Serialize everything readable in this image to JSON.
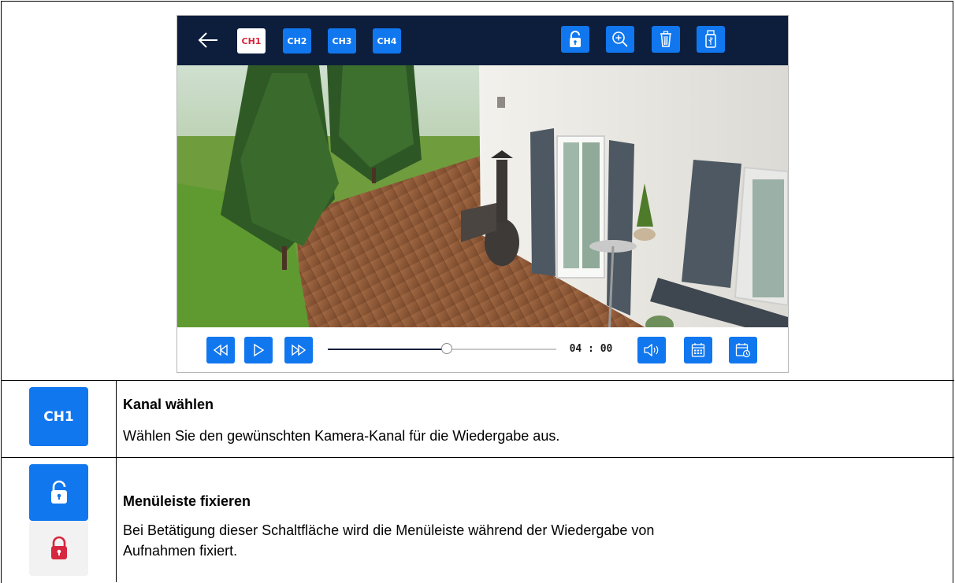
{
  "device": {
    "channels": [
      {
        "label": "CH1",
        "active": true
      },
      {
        "label": "CH2",
        "active": false
      },
      {
        "label": "CH3",
        "active": false
      },
      {
        "label": "CH4",
        "active": false
      }
    ],
    "toolbar_icons": [
      "lock-open-icon",
      "zoom-in-icon",
      "trash-icon",
      "usb-icon"
    ],
    "playback_icons": [
      "rewind-icon",
      "play-icon",
      "fast-forward-icon"
    ],
    "right_icons": [
      "volume-icon",
      "calendar-icon",
      "calendar-time-icon"
    ],
    "time": "04 : 00",
    "progress": 0.52,
    "colors": {
      "bar": "#0d1e3d",
      "accent": "#1177ee",
      "active_text": "#d7263d",
      "lock_red": "#d7263d"
    }
  },
  "legend": {
    "row1": {
      "icon_label": "CH1",
      "title": "Kanal wählen",
      "description": "Wählen Sie den gewünschten Kamera-Kanal für die Wiedergabe aus."
    },
    "row2": {
      "title": "Menüleiste fixieren",
      "description_line1": "Bei Betätigung dieser Schaltfläche wird die Menüleiste während der Wiedergabe von",
      "description_line2": "Aufnahmen fixiert."
    }
  }
}
